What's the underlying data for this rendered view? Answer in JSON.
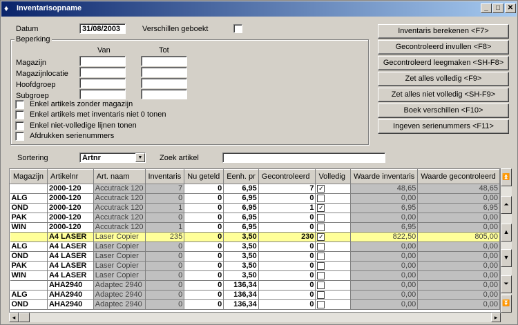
{
  "window": {
    "title": "Inventarisopname",
    "min": "_",
    "max": "□",
    "close": "✕"
  },
  "form": {
    "datum_label": "Datum",
    "datum_value": "31/08/2003",
    "verschillen_label": "Verschillen geboekt",
    "beperking_label": "Beperking",
    "van_label": "Van",
    "tot_label": "Tot",
    "rows": [
      "Magazijn",
      "Magazijnlocatie",
      "Hoofdgroep",
      "Subgroep"
    ],
    "checks": [
      "Enkel artikels zonder magazijn",
      "Enkel artikels met inventaris niet 0 tonen",
      "Enkel niet-volledige lijnen tonen",
      "Afdrukken serienummers"
    ],
    "sortering_label": "Sortering",
    "sortering_value": "Artnr",
    "zoek_label": "Zoek artikel",
    "zoek_value": ""
  },
  "buttons": [
    "Inventaris berekenen <F7>",
    "Gecontroleerd invullen <F8>",
    "Gecontroleerd leegmaken <SH-F8>",
    "Zet alles volledig <F9>",
    "Zet alles niet volledig <SH-F9>",
    "Boek verschillen <F10>",
    "Ingeven serienummers <F11>"
  ],
  "grid": {
    "columns": [
      "Magazijn",
      "Artikelnr",
      "Art. naam",
      "Inventaris",
      "Nu geteld",
      "Eenh. pr",
      "Gecontroleerd",
      "Volledig",
      "Waarde inventaris",
      "Waarde gecontroleerd"
    ],
    "rows": [
      {
        "mag": "",
        "art": "2000-120",
        "naam": "Accutrack 120",
        "inv": "7",
        "nu": "0",
        "pr": "6,95",
        "gec": "7",
        "vol": true,
        "wi": "48,65",
        "wg": "48,65",
        "hl": false
      },
      {
        "mag": "ALG",
        "art": "2000-120",
        "naam": "Accutrack 120",
        "inv": "0",
        "nu": "0",
        "pr": "6,95",
        "gec": "0",
        "vol": false,
        "wi": "0,00",
        "wg": "0,00",
        "hl": false
      },
      {
        "mag": "OND",
        "art": "2000-120",
        "naam": "Accutrack 120",
        "inv": "1",
        "nu": "0",
        "pr": "6,95",
        "gec": "1",
        "vol": true,
        "wi": "6,95",
        "wg": "6,95",
        "hl": false
      },
      {
        "mag": "PAK",
        "art": "2000-120",
        "naam": "Accutrack 120",
        "inv": "0",
        "nu": "0",
        "pr": "6,95",
        "gec": "0",
        "vol": false,
        "wi": "0,00",
        "wg": "0,00",
        "hl": false
      },
      {
        "mag": "WIN",
        "art": "2000-120",
        "naam": "Accutrack 120",
        "inv": "1",
        "nu": "0",
        "pr": "6,95",
        "gec": "0",
        "vol": false,
        "wi": "6,95",
        "wg": "0,00",
        "hl": false
      },
      {
        "mag": "",
        "art": "A4 LASER",
        "naam": "Laser Copier",
        "inv": "235",
        "nu": "0",
        "pr": "3,50",
        "gec": "230",
        "vol": true,
        "wi": "822,50",
        "wg": "805,00",
        "hl": true
      },
      {
        "mag": "ALG",
        "art": "A4 LASER",
        "naam": "Laser Copier",
        "inv": "0",
        "nu": "0",
        "pr": "3,50",
        "gec": "0",
        "vol": false,
        "wi": "0,00",
        "wg": "0,00",
        "hl": false
      },
      {
        "mag": "OND",
        "art": "A4 LASER",
        "naam": "Laser Copier",
        "inv": "0",
        "nu": "0",
        "pr": "3,50",
        "gec": "0",
        "vol": false,
        "wi": "0,00",
        "wg": "0,00",
        "hl": false
      },
      {
        "mag": "PAK",
        "art": "A4 LASER",
        "naam": "Laser Copier",
        "inv": "0",
        "nu": "0",
        "pr": "3,50",
        "gec": "0",
        "vol": false,
        "wi": "0,00",
        "wg": "0,00",
        "hl": false
      },
      {
        "mag": "WIN",
        "art": "A4 LASER",
        "naam": "Laser Copier",
        "inv": "0",
        "nu": "0",
        "pr": "3,50",
        "gec": "0",
        "vol": false,
        "wi": "0,00",
        "wg": "0,00",
        "hl": false
      },
      {
        "mag": "",
        "art": "AHA2940",
        "naam": "Adaptec 2940",
        "inv": "0",
        "nu": "0",
        "pr": "136,34",
        "gec": "0",
        "vol": false,
        "wi": "0,00",
        "wg": "0,00",
        "hl": false
      },
      {
        "mag": "ALG",
        "art": "AHA2940",
        "naam": "Adaptec 2940",
        "inv": "0",
        "nu": "0",
        "pr": "136,34",
        "gec": "0",
        "vol": false,
        "wi": "0,00",
        "wg": "0,00",
        "hl": false
      },
      {
        "mag": "OND",
        "art": "AHA2940",
        "naam": "Adaptec 2940",
        "inv": "0",
        "nu": "0",
        "pr": "136,34",
        "gec": "0",
        "vol": false,
        "wi": "0,00",
        "wg": "0,00",
        "hl": false
      }
    ]
  },
  "scroll": {
    "left_arrow": "◂",
    "right_arrow": "▸",
    "up_arrow": "▲",
    "down_arrow": "▼"
  }
}
